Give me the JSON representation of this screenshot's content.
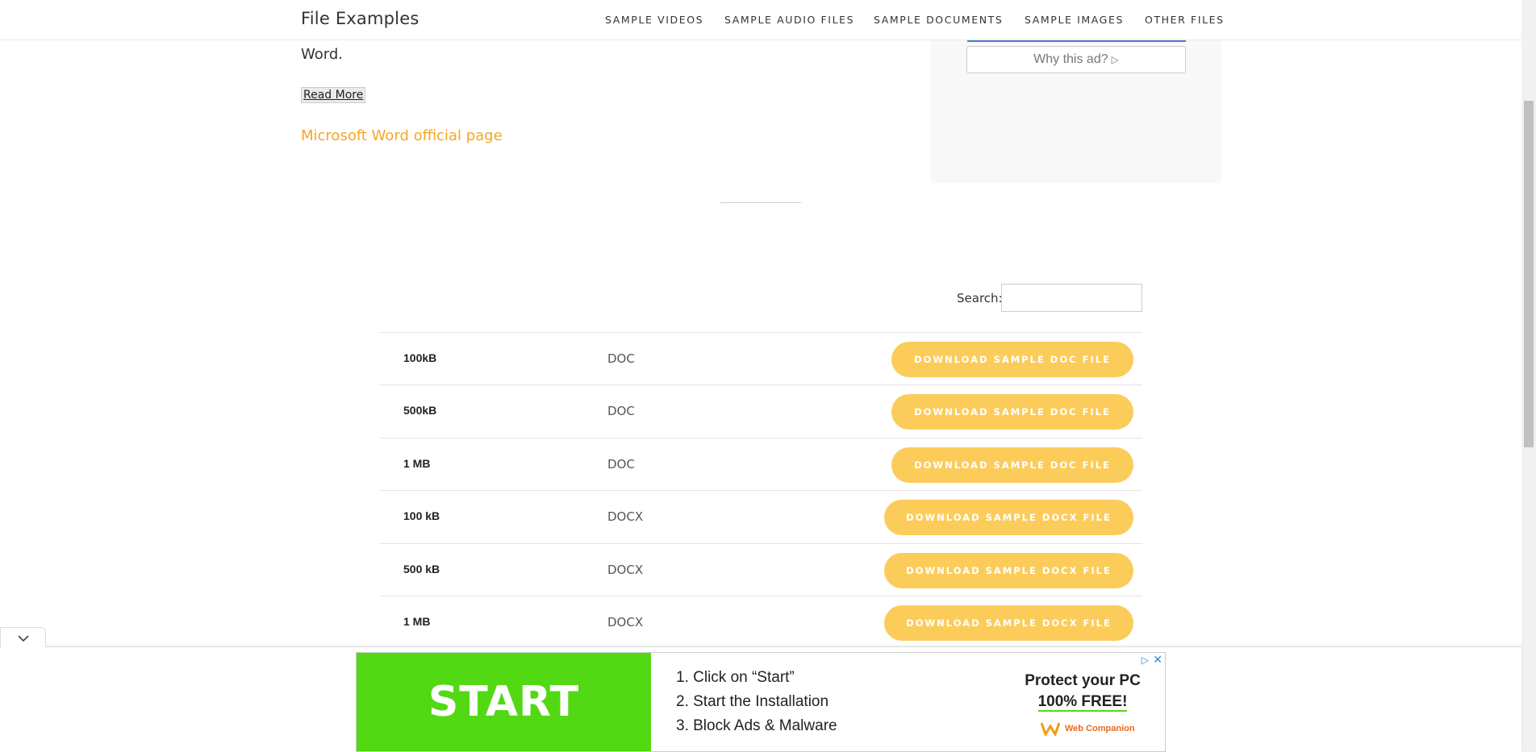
{
  "header": {
    "site_title": "File Examples",
    "nav": [
      "SAMPLE VIDEOS",
      "SAMPLE AUDIO FILES",
      "SAMPLE DOCUMENTS",
      "SAMPLE IMAGES",
      "OTHER FILES"
    ]
  },
  "content": {
    "word_line": "Word.",
    "read_more": "Read More",
    "official_link": "Microsoft Word official page"
  },
  "sidebar_ad": {
    "why_ad": "Why this ad?"
  },
  "search": {
    "label": "Search:",
    "value": ""
  },
  "table": {
    "rows": [
      {
        "size": "100kB",
        "type": "DOC",
        "button": "DOWNLOAD SAMPLE DOC FILE"
      },
      {
        "size": "500kB",
        "type": "DOC",
        "button": "DOWNLOAD SAMPLE DOC FILE"
      },
      {
        "size": "1 MB",
        "type": "DOC",
        "button": "DOWNLOAD SAMPLE DOC FILE"
      },
      {
        "size": "100 kB",
        "type": "DOCX",
        "button": "DOWNLOAD SAMPLE DOCX FILE"
      },
      {
        "size": "500 kB",
        "type": "DOCX",
        "button": "DOWNLOAD SAMPLE DOCX FILE"
      },
      {
        "size": "1 MB",
        "type": "DOCX",
        "button": "DOWNLOAD SAMPLE DOCX FILE"
      }
    ]
  },
  "bottom_ad": {
    "cta": "START",
    "steps": [
      "1. Click on “Start”",
      "2. Start the Installation",
      "3. Block Ads & Malware"
    ],
    "protect_line1": "Protect your PC",
    "protect_line2": "100% FREE!",
    "brand": "Web Companion"
  },
  "colors": {
    "accent": "#fccc5b",
    "link": "#f5a623",
    "ad_green": "#52d914"
  }
}
